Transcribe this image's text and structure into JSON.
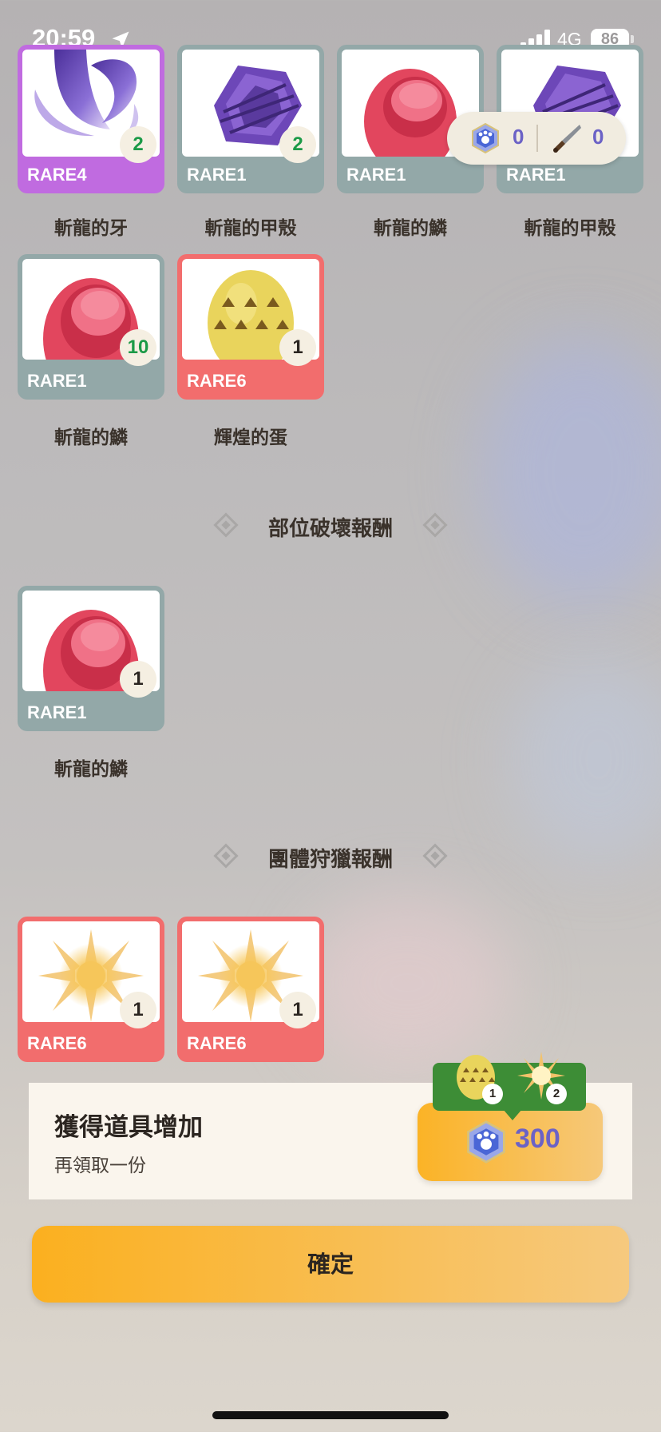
{
  "status_bar": {
    "time": "20:59",
    "network": "4G",
    "battery": "86"
  },
  "currency_pill": {
    "gem_count": "0",
    "knife_count": "0"
  },
  "top_row": [
    {
      "rarity": "RARE4",
      "qty": "2",
      "name": "斬龍的牙"
    },
    {
      "rarity": "RARE1",
      "qty": "2",
      "name": "斬龍的甲殼"
    },
    {
      "rarity": "RARE1",
      "qty": "",
      "name": "斬龍的鱗"
    },
    {
      "rarity": "RARE1",
      "qty": "",
      "name": "斬龍的甲殼"
    }
  ],
  "second_row": [
    {
      "rarity": "RARE1",
      "qty": "10",
      "name": "斬龍的鱗"
    },
    {
      "rarity": "RARE6",
      "qty": "1",
      "name": "輝煌的蛋"
    }
  ],
  "part_break": {
    "title": "部位破壞報酬",
    "items": [
      {
        "rarity": "RARE1",
        "qty": "1",
        "name": "斬龍的鱗"
      }
    ]
  },
  "group_hunt": {
    "title": "團體狩獵報酬",
    "items": [
      {
        "rarity": "RARE6",
        "qty": "1"
      },
      {
        "rarity": "RARE6",
        "qty": "1"
      }
    ]
  },
  "bonus": {
    "title": "獲得道具增加",
    "subtitle": "再領取一份",
    "cost": "300",
    "preview_egg_qty": "1",
    "preview_sun_qty": "2"
  },
  "confirm_label": "確定",
  "colors": {
    "rare1": "#93a8a8",
    "rare4": "#c06be0",
    "rare6": "#f26d6d",
    "accent": "#fbb326",
    "gem": "#6b62c6"
  }
}
